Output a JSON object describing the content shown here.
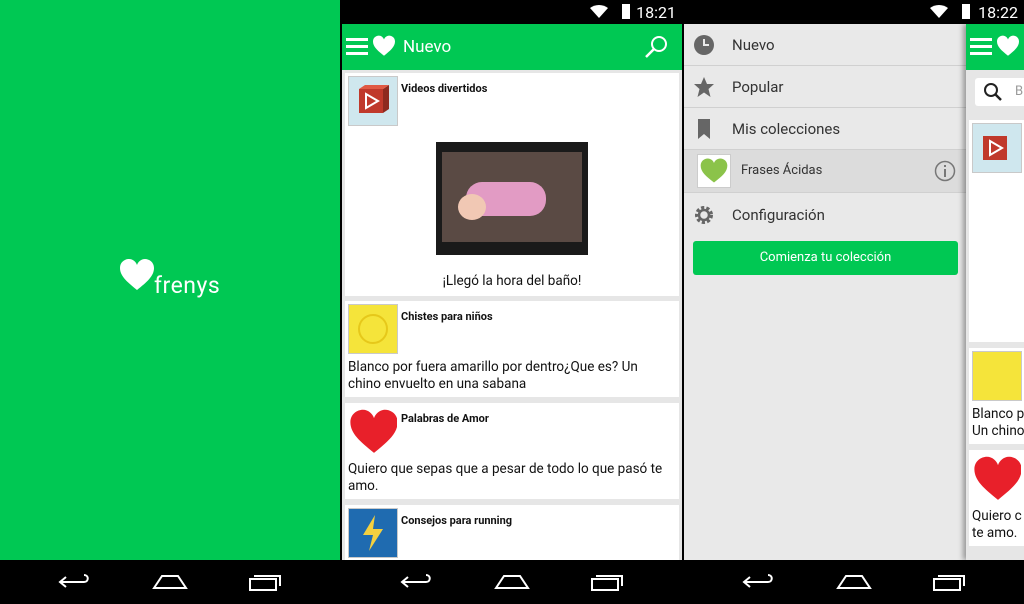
{
  "status": {
    "time_screen2": "18:21",
    "time_screen3": "18:22"
  },
  "splash": {
    "brand": "frenys"
  },
  "feed": {
    "title": "Nuevo",
    "cards": [
      {
        "collection": "Videos divertidos",
        "text": "¡Llegó la hora del baño!"
      },
      {
        "collection": "Chistes para niños",
        "text": "Blanco por fuera amarillo por dentro¿Que es? Un chino envuelto en una sabana"
      },
      {
        "collection": "Palabras de Amor",
        "text": "Quiero que sepas que a pesar de todo lo que pasó te amo."
      },
      {
        "collection": "Consejos para running",
        "text": ""
      }
    ]
  },
  "drawer": {
    "items": [
      "Nuevo",
      "Popular",
      "Mis colecciones"
    ],
    "collection": "Frases Ácidas",
    "settings": "Configuración",
    "cta": "Comienza tu colección"
  },
  "peek": {
    "search_hint": "B",
    "text1": "Blanco p",
    "text1b": "Un chino",
    "text2": "Quiero c",
    "text2b": "te amo."
  },
  "colors": {
    "brand": "#00c853",
    "background": "#e6e6e6"
  }
}
